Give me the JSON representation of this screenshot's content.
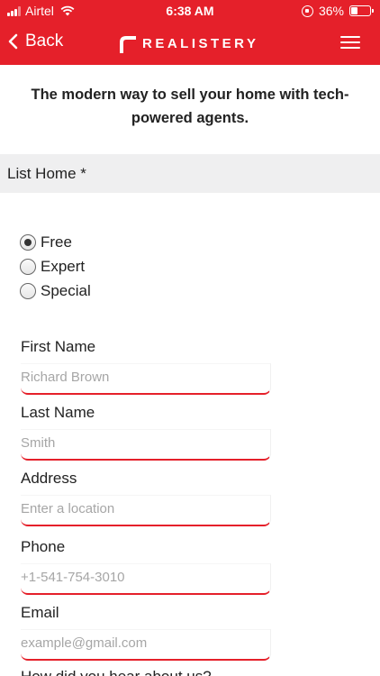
{
  "status_bar": {
    "carrier": "Airtel",
    "time": "6:38 AM",
    "battery": "36%",
    "battery_level": 0.36
  },
  "nav": {
    "back_label": "Back",
    "logo_text": "REALISTERY"
  },
  "tagline": "The modern way to sell your home with tech-powered agents.",
  "list_home": {
    "label": "List Home *",
    "options": [
      "Free",
      "Expert",
      "Special"
    ],
    "selected": "Free"
  },
  "fields": {
    "first_name": {
      "label": "First Name",
      "placeholder": "Richard Brown"
    },
    "last_name": {
      "label": "Last Name",
      "placeholder": "Smith"
    },
    "address": {
      "label": "Address",
      "placeholder": "Enter a location"
    },
    "phone": {
      "label": "Phone",
      "placeholder": "+1-541-754-3010"
    },
    "email": {
      "label": "Email",
      "placeholder": "example@gmail.com"
    }
  },
  "next_question": "How did you hear about us?",
  "colors": {
    "brand": "#e5202a",
    "section_bg": "#efeff0"
  }
}
